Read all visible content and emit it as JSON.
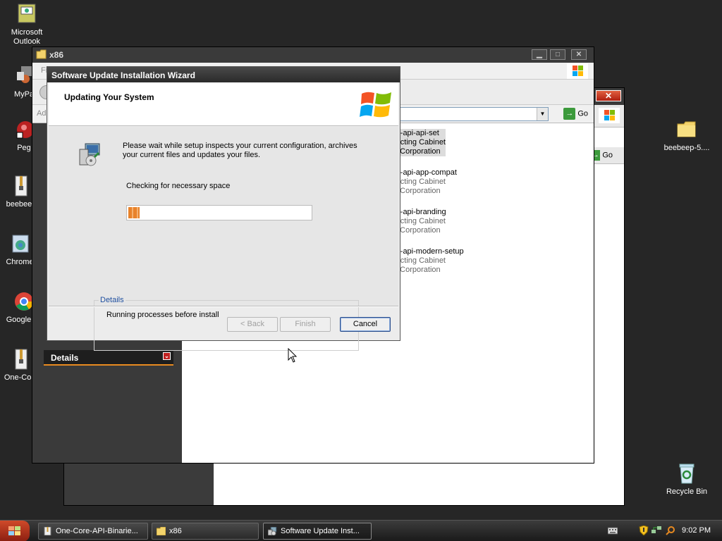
{
  "desktop": {
    "icons_left": [
      {
        "label": "Microsoft Outlook",
        "icon": "outlook-icon"
      },
      {
        "label": "MyPa",
        "icon": "mypc-icon"
      },
      {
        "label": "Peg",
        "icon": "peg-icon"
      },
      {
        "label": "beebeep",
        "icon": "zip-icon"
      },
      {
        "label": "Chrome",
        "icon": "chrome-installer-icon"
      },
      {
        "label": "Google C",
        "icon": "chrome-icon"
      },
      {
        "label": "One-Core",
        "icon": "zip-icon"
      }
    ],
    "icons_right": [
      {
        "label": "beebeep-5....",
        "icon": "folder-icon"
      },
      {
        "label": "Recycle Bin",
        "icon": "recycle-bin-icon"
      }
    ]
  },
  "explorer_x86": {
    "title": "x86",
    "menu_fragment": "Fi",
    "addr_fragment": "Ad",
    "go_label": "Go",
    "details_label": "Details",
    "files": [
      {
        "name": "re-api-api-set",
        "type": "racting Cabinet",
        "company": "ft Corporation"
      },
      {
        "name": "re-api-app-compat",
        "type": "racting Cabinet",
        "company": "ft Corporation"
      },
      {
        "name": "re-api-branding",
        "type": "racting Cabinet",
        "company": "ft Corporation"
      },
      {
        "name": "re-api-modern-setup",
        "type": "racting Cabinet",
        "company": "ft Corporation"
      }
    ]
  },
  "explorer_back": {
    "go_label": "Go"
  },
  "wizard": {
    "title": "Software Update Installation Wizard",
    "header": "Updating Your System",
    "description": "Please wait while setup inspects your current configuration, archives your current files and updates your files.",
    "status": "Checking for necessary space",
    "progress_fraction": 0.06,
    "details_legend": "Details",
    "details_text": "Running processes before install",
    "buttons": {
      "back": "< Back",
      "finish": "Finish",
      "cancel": "Cancel"
    }
  },
  "taskbar": {
    "buttons": [
      {
        "label": "One-Core-API-Binarie...",
        "icon": "zip-icon"
      },
      {
        "label": "x86",
        "icon": "folder-icon"
      },
      {
        "label": "Software Update Inst...",
        "icon": "setup-icon"
      }
    ],
    "clock": "9:02 PM"
  },
  "colors": {
    "accent_orange": "#e8822a",
    "desktop_bg": "#262626",
    "link_blue": "#2050a0"
  }
}
